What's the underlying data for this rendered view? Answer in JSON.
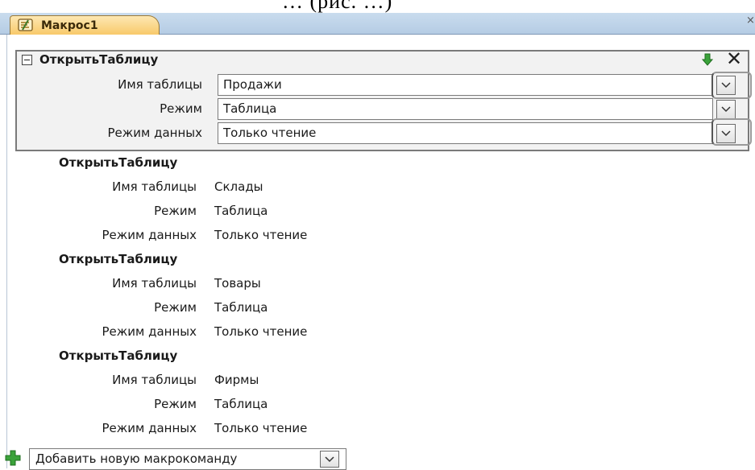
{
  "header_fragment": "… (рис. …)",
  "tab": {
    "title": "Макрос1",
    "close_glyph": "×"
  },
  "expanded_action": {
    "title": "ОткрытьТаблицу",
    "rows": [
      {
        "label": "Имя таблицы",
        "value": "Продажи"
      },
      {
        "label": "Режим",
        "value": "Таблица"
      },
      {
        "label": "Режим данных",
        "value": "Только чтение"
      }
    ],
    "delete_glyph": "✕"
  },
  "actions": [
    {
      "title": "ОткрытьТаблицу",
      "rows": [
        {
          "label": "Имя таблицы",
          "value": "Склады"
        },
        {
          "label": "Режим",
          "value": "Таблица"
        },
        {
          "label": "Режим данных",
          "value": "Только чтение"
        }
      ]
    },
    {
      "title": "ОткрытьТаблицу",
      "rows": [
        {
          "label": "Имя таблицы",
          "value": "Товары"
        },
        {
          "label": "Режим",
          "value": "Таблица"
        },
        {
          "label": "Режим данных",
          "value": "Только чтение"
        }
      ]
    },
    {
      "title": "ОткрытьТаблицу",
      "rows": [
        {
          "label": "Имя таблицы",
          "value": "Фирмы"
        },
        {
          "label": "Режим",
          "value": "Таблица"
        },
        {
          "label": "Режим данных",
          "value": "Только чтение"
        }
      ]
    }
  ],
  "add_action": {
    "label": "Добавить новую макрокоманду"
  },
  "icons": {
    "tab": "macro-icon",
    "move_down": "green-arrow-down-icon",
    "add": "green-plus-icon",
    "dropdown": "chevron-down-icon"
  },
  "colors": {
    "tab_bg": "#f8c96a",
    "tabbar_bg": "#c9dcee",
    "block_bg": "#f2f2f2",
    "green": "#3aa23a"
  }
}
